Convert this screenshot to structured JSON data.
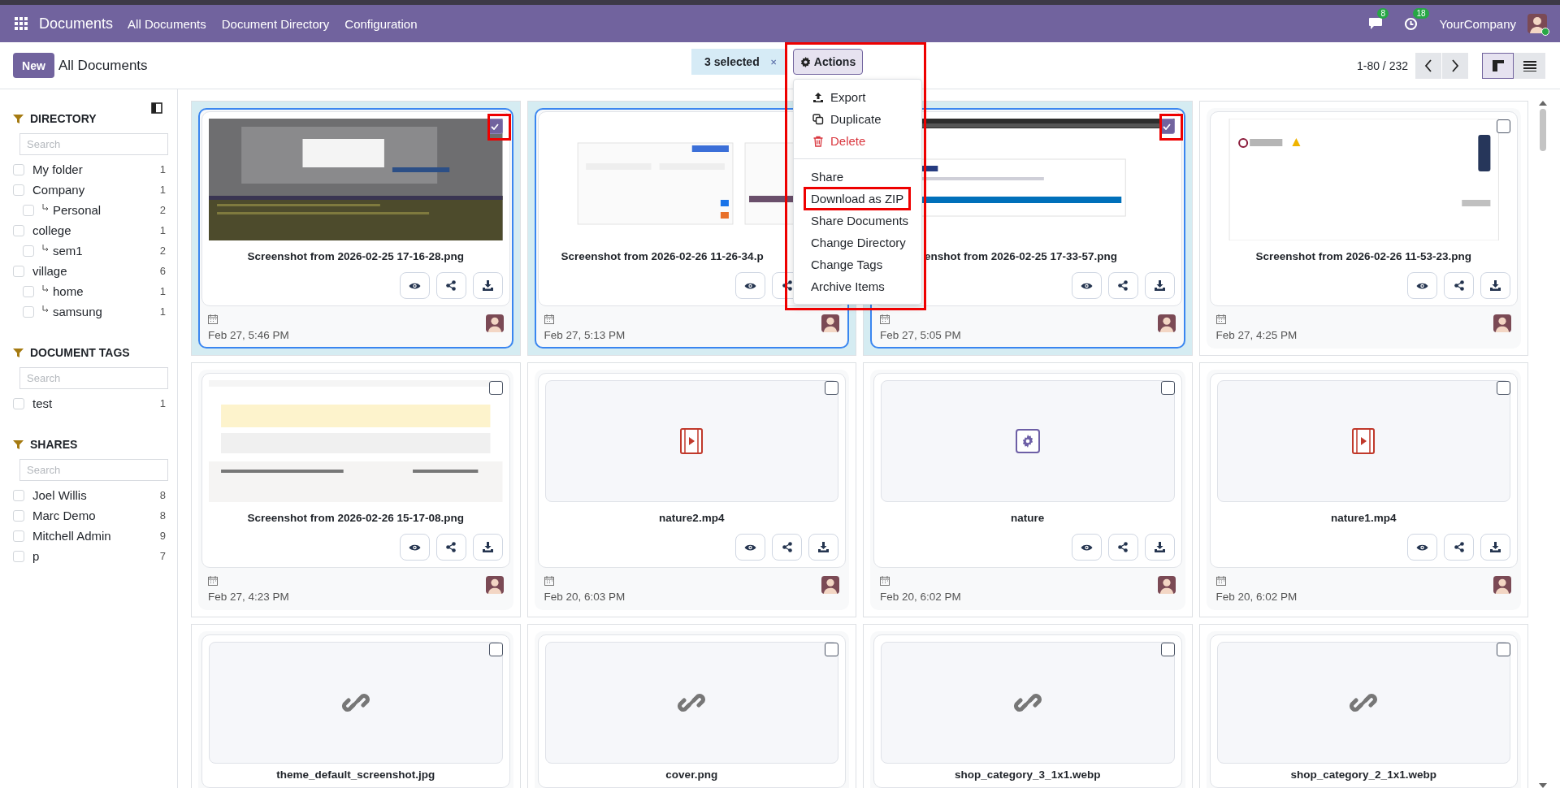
{
  "navbar": {
    "app_name": "Documents",
    "menu": [
      {
        "label": "All Documents"
      },
      {
        "label": "Document Directory"
      },
      {
        "label": "Configuration"
      }
    ],
    "messages_badge": "8",
    "activities_badge": "18",
    "company": "YourCompany"
  },
  "control_panel": {
    "new_button": "New",
    "title": "All Documents",
    "selection": "3 selected",
    "actions_button": "Actions",
    "pager": "1-80 / 232",
    "views": [
      {
        "kind": "kanban",
        "selected": true
      },
      {
        "kind": "list",
        "selected": false
      }
    ]
  },
  "actions_menu": {
    "highlighted": true,
    "sections": [
      {
        "items": [
          {
            "label": "Export",
            "kind": "export",
            "highlighted": false
          },
          {
            "label": "Duplicate",
            "kind": "duplicate",
            "highlighted": false
          },
          {
            "label": "Delete",
            "kind": "delete",
            "highlighted": false
          }
        ]
      },
      {
        "items": [
          {
            "label": "Share",
            "kind": "plain",
            "highlighted": false
          },
          {
            "label": "Download as ZIP",
            "kind": "plain",
            "highlighted": true
          },
          {
            "label": "Share Documents",
            "kind": "plain",
            "highlighted": false
          },
          {
            "label": "Change Directory",
            "kind": "plain",
            "highlighted": false
          },
          {
            "label": "Change Tags",
            "kind": "plain",
            "highlighted": false
          },
          {
            "label": "Archive Items",
            "kind": "plain",
            "highlighted": false
          }
        ]
      }
    ]
  },
  "sidebar": {
    "sections": [
      {
        "title": "DIRECTORY",
        "search_placeholder": "Search",
        "items": [
          {
            "label": "My folder",
            "count": "1",
            "checked": false
          },
          {
            "label": "Company",
            "count": "1",
            "checked": false,
            "children": [
              {
                "label": "Personal",
                "count": "2",
                "checked": false
              }
            ]
          },
          {
            "label": "college",
            "count": "1",
            "checked": false,
            "children": [
              {
                "label": "sem1",
                "count": "2",
                "checked": false
              }
            ]
          },
          {
            "label": "village",
            "count": "6",
            "checked": false,
            "children": [
              {
                "label": "home",
                "count": "1",
                "checked": false
              },
              {
                "label": "samsung",
                "count": "1",
                "checked": false
              }
            ]
          }
        ]
      },
      {
        "title": "DOCUMENT TAGS",
        "search_placeholder": "Search",
        "items": [
          {
            "label": "test",
            "count": "1",
            "checked": false
          }
        ]
      },
      {
        "title": "SHARES",
        "search_placeholder": "Search",
        "items": [
          {
            "label": "Joel Willis",
            "count": "8",
            "checked": false
          },
          {
            "label": "Marc Demo",
            "count": "8",
            "checked": false
          },
          {
            "label": "Mitchell Admin",
            "count": "9",
            "checked": false
          },
          {
            "label": "p",
            "count": "7",
            "checked": false
          }
        ]
      }
    ]
  },
  "cards": [
    {
      "name": "Screenshot from 2026-02-25 17-16-28.png",
      "date": "Feb 27, 5:46 PM",
      "selected": true,
      "highlighted": true
    },
    {
      "name": "Screenshot from 2026-02-26 11-26-34.p",
      "date": "Feb 27, 5:13 PM",
      "selected": true
    },
    {
      "name": "enshot from 2026-02-25 17-33-57.png",
      "date": "Feb 27, 5:05 PM",
      "selected": true,
      "highlighted": true
    },
    {
      "name": "Screenshot from 2026-02-26 11-53-23.png",
      "date": "Feb 27, 4:25 PM",
      "selected": false
    },
    {
      "name": "Screenshot from 2026-02-26 15-17-08.png",
      "date": "Feb 27, 4:23 PM",
      "selected": false
    },
    {
      "name": "nature2.mp4",
      "date": "Feb 20, 6:03 PM",
      "selected": false,
      "preview": {
        "kind": "video"
      }
    },
    {
      "name": "nature",
      "date": "Feb 20, 6:02 PM",
      "selected": false,
      "preview": {
        "kind": "gear"
      }
    },
    {
      "name": "nature1.mp4",
      "date": "Feb 20, 6:02 PM",
      "selected": false,
      "preview": {
        "kind": "video"
      }
    },
    {
      "name": "theme_default_screenshot.jpg",
      "selected": false,
      "preview": {
        "kind": "link"
      }
    },
    {
      "name": "cover.png",
      "selected": false,
      "preview": {
        "kind": "link"
      }
    },
    {
      "name": "shop_category_3_1x1.webp",
      "selected": false,
      "preview": {
        "kind": "link"
      }
    },
    {
      "name": "shop_category_2_1x1.webp",
      "selected": false,
      "preview": {
        "kind": "link"
      }
    }
  ]
}
